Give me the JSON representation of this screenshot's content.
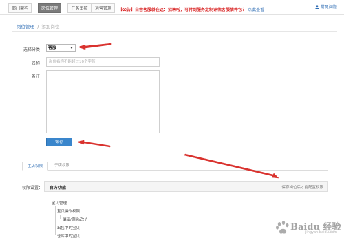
{
  "topnav": {
    "tabs": [
      {
        "label": "部门架构",
        "active": false
      },
      {
        "label": "岗位管理",
        "active": true
      },
      {
        "label": "任务审核",
        "active": false
      },
      {
        "label": "运营管理",
        "active": false
      }
    ],
    "notice": "【公告】自营客服就在这：招聘啦，可付到服务定制评估客服情件包？",
    "notice_link": "点此查看",
    "help_label": "常见问题"
  },
  "breadcrumb": {
    "parent": "岗位管理",
    "separator": "/",
    "current": "添加岗位"
  },
  "form": {
    "category_label": "选择分类：",
    "category_value": "客服",
    "name_label": "名称：",
    "name_placeholder": "岗位名称不能超过10个字符",
    "remark_label": "备注：",
    "save_label": "保存"
  },
  "permission_tabs": [
    {
      "label": "主店权限",
      "active": true
    },
    {
      "label": "子店权限",
      "active": false
    }
  ],
  "permission": {
    "label": "权限设置：",
    "section_title": "官方功能",
    "hint": "保存岗位后才能配置权限"
  },
  "tree": [
    {
      "label": "宝贝管理",
      "level": 0
    },
    {
      "label": "宝贝操作权限",
      "level": 1
    },
    {
      "label": "编辑/删除/改价",
      "level": 2
    },
    {
      "label": "出售中的宝贝",
      "level": 1
    },
    {
      "label": "仓库中的宝贝",
      "level": 1
    }
  ],
  "watermark": {
    "text": "Baidu 经验",
    "url": "jingyan.baidu.com"
  },
  "colors": {
    "accent": "#3a86cc",
    "notice_red": "#d82020",
    "link_blue": "#2e6db4",
    "arrow_red": "#d9322e"
  }
}
